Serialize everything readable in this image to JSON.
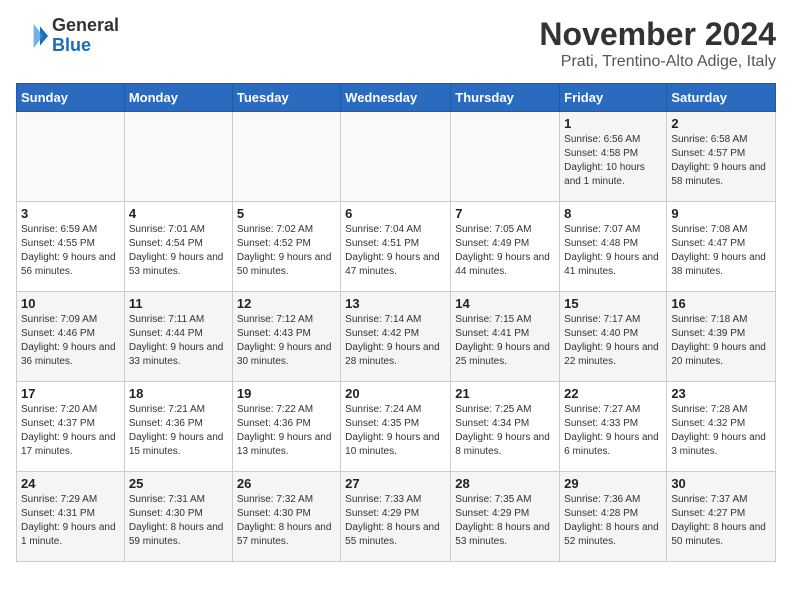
{
  "logo": {
    "general": "General",
    "blue": "Blue"
  },
  "header": {
    "month_year": "November 2024",
    "location": "Prati, Trentino-Alto Adige, Italy"
  },
  "weekdays": [
    "Sunday",
    "Monday",
    "Tuesday",
    "Wednesday",
    "Thursday",
    "Friday",
    "Saturday"
  ],
  "weeks": [
    [
      {
        "day": "",
        "info": ""
      },
      {
        "day": "",
        "info": ""
      },
      {
        "day": "",
        "info": ""
      },
      {
        "day": "",
        "info": ""
      },
      {
        "day": "",
        "info": ""
      },
      {
        "day": "1",
        "info": "Sunrise: 6:56 AM\nSunset: 4:58 PM\nDaylight: 10 hours and 1 minute."
      },
      {
        "day": "2",
        "info": "Sunrise: 6:58 AM\nSunset: 4:57 PM\nDaylight: 9 hours and 58 minutes."
      }
    ],
    [
      {
        "day": "3",
        "info": "Sunrise: 6:59 AM\nSunset: 4:55 PM\nDaylight: 9 hours and 56 minutes."
      },
      {
        "day": "4",
        "info": "Sunrise: 7:01 AM\nSunset: 4:54 PM\nDaylight: 9 hours and 53 minutes."
      },
      {
        "day": "5",
        "info": "Sunrise: 7:02 AM\nSunset: 4:52 PM\nDaylight: 9 hours and 50 minutes."
      },
      {
        "day": "6",
        "info": "Sunrise: 7:04 AM\nSunset: 4:51 PM\nDaylight: 9 hours and 47 minutes."
      },
      {
        "day": "7",
        "info": "Sunrise: 7:05 AM\nSunset: 4:49 PM\nDaylight: 9 hours and 44 minutes."
      },
      {
        "day": "8",
        "info": "Sunrise: 7:07 AM\nSunset: 4:48 PM\nDaylight: 9 hours and 41 minutes."
      },
      {
        "day": "9",
        "info": "Sunrise: 7:08 AM\nSunset: 4:47 PM\nDaylight: 9 hours and 38 minutes."
      }
    ],
    [
      {
        "day": "10",
        "info": "Sunrise: 7:09 AM\nSunset: 4:46 PM\nDaylight: 9 hours and 36 minutes."
      },
      {
        "day": "11",
        "info": "Sunrise: 7:11 AM\nSunset: 4:44 PM\nDaylight: 9 hours and 33 minutes."
      },
      {
        "day": "12",
        "info": "Sunrise: 7:12 AM\nSunset: 4:43 PM\nDaylight: 9 hours and 30 minutes."
      },
      {
        "day": "13",
        "info": "Sunrise: 7:14 AM\nSunset: 4:42 PM\nDaylight: 9 hours and 28 minutes."
      },
      {
        "day": "14",
        "info": "Sunrise: 7:15 AM\nSunset: 4:41 PM\nDaylight: 9 hours and 25 minutes."
      },
      {
        "day": "15",
        "info": "Sunrise: 7:17 AM\nSunset: 4:40 PM\nDaylight: 9 hours and 22 minutes."
      },
      {
        "day": "16",
        "info": "Sunrise: 7:18 AM\nSunset: 4:39 PM\nDaylight: 9 hours and 20 minutes."
      }
    ],
    [
      {
        "day": "17",
        "info": "Sunrise: 7:20 AM\nSunset: 4:37 PM\nDaylight: 9 hours and 17 minutes."
      },
      {
        "day": "18",
        "info": "Sunrise: 7:21 AM\nSunset: 4:36 PM\nDaylight: 9 hours and 15 minutes."
      },
      {
        "day": "19",
        "info": "Sunrise: 7:22 AM\nSunset: 4:36 PM\nDaylight: 9 hours and 13 minutes."
      },
      {
        "day": "20",
        "info": "Sunrise: 7:24 AM\nSunset: 4:35 PM\nDaylight: 9 hours and 10 minutes."
      },
      {
        "day": "21",
        "info": "Sunrise: 7:25 AM\nSunset: 4:34 PM\nDaylight: 9 hours and 8 minutes."
      },
      {
        "day": "22",
        "info": "Sunrise: 7:27 AM\nSunset: 4:33 PM\nDaylight: 9 hours and 6 minutes."
      },
      {
        "day": "23",
        "info": "Sunrise: 7:28 AM\nSunset: 4:32 PM\nDaylight: 9 hours and 3 minutes."
      }
    ],
    [
      {
        "day": "24",
        "info": "Sunrise: 7:29 AM\nSunset: 4:31 PM\nDaylight: 9 hours and 1 minute."
      },
      {
        "day": "25",
        "info": "Sunrise: 7:31 AM\nSunset: 4:30 PM\nDaylight: 8 hours and 59 minutes."
      },
      {
        "day": "26",
        "info": "Sunrise: 7:32 AM\nSunset: 4:30 PM\nDaylight: 8 hours and 57 minutes."
      },
      {
        "day": "27",
        "info": "Sunrise: 7:33 AM\nSunset: 4:29 PM\nDaylight: 8 hours and 55 minutes."
      },
      {
        "day": "28",
        "info": "Sunrise: 7:35 AM\nSunset: 4:29 PM\nDaylight: 8 hours and 53 minutes."
      },
      {
        "day": "29",
        "info": "Sunrise: 7:36 AM\nSunset: 4:28 PM\nDaylight: 8 hours and 52 minutes."
      },
      {
        "day": "30",
        "info": "Sunrise: 7:37 AM\nSunset: 4:27 PM\nDaylight: 8 hours and 50 minutes."
      }
    ]
  ]
}
